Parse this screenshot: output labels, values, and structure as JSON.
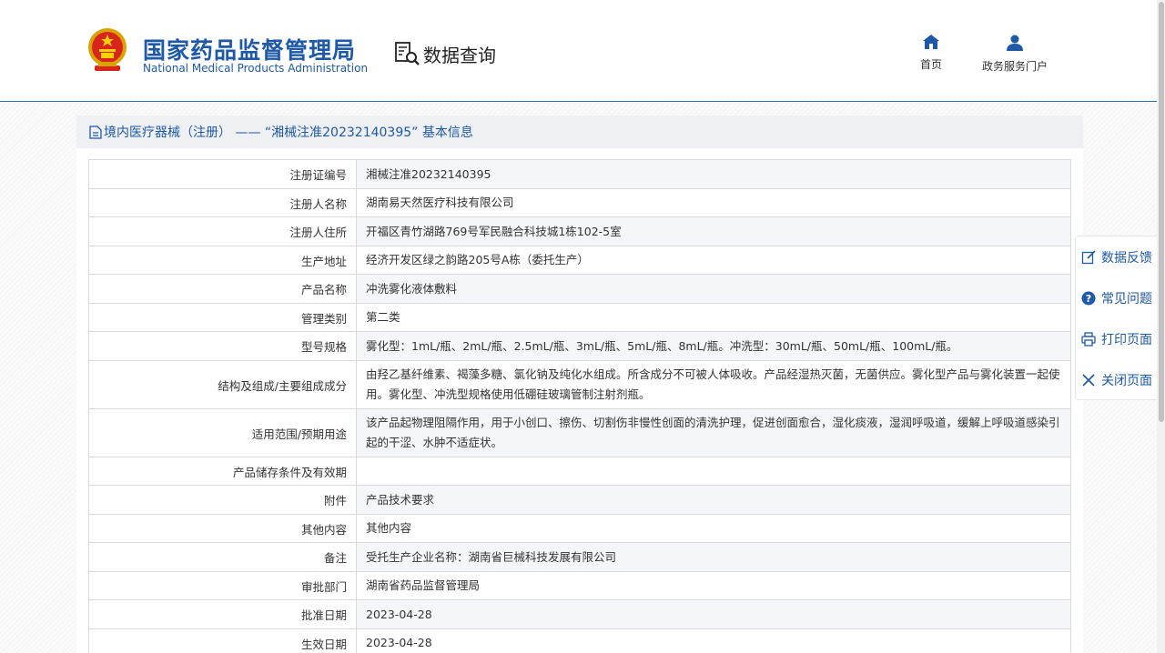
{
  "header": {
    "title_cn": "国家药品监督管理局",
    "title_en": "National Medical Products Administration",
    "query_label": "数据查询",
    "nav": [
      {
        "label": "首页",
        "icon": "home-icon"
      },
      {
        "label": "政务服务门户",
        "icon": "user-icon"
      }
    ]
  },
  "panel": {
    "title": "境内医疗器械（注册） —— “湘械注准20232140395” 基本信息"
  },
  "record": {
    "rows": [
      {
        "label": "注册证编号",
        "value": "湘械注准20232140395"
      },
      {
        "label": "注册人名称",
        "value": "湖南易天然医疗科技有限公司"
      },
      {
        "label": "注册人住所",
        "value": "开福区青竹湖路769号军民融合科技城1栋102-5室"
      },
      {
        "label": "生产地址",
        "value": "经济开发区绿之韵路205号A栋（委托生产）"
      },
      {
        "label": "产品名称",
        "value": "冲洗雾化液体敷料"
      },
      {
        "label": "管理类别",
        "value": "第二类"
      },
      {
        "label": "型号规格",
        "value": "雾化型：1mL/瓶、2mL/瓶、2.5mL/瓶、3mL/瓶、5mL/瓶、8mL/瓶。冲洗型：30mL/瓶、50mL/瓶、100mL/瓶。"
      },
      {
        "label": "结构及组成/主要组成成分",
        "value": "由羟乙基纤维素、褐藻多糖、氯化钠及纯化水组成。所含成分不可被人体吸收。产品经湿热灭菌，无菌供应。雾化型产品与雾化装置一起使用。雾化型、冲洗型规格使用低硼硅玻璃管制注射剂瓶。"
      },
      {
        "label": "适用范围/预期用途",
        "value": "该产品起物理阻隔作用，用于小创口、擦伤、切割伤非慢性创面的清洗护理，促进创面愈合，湿化痰液，湿润呼吸道，缓解上呼吸道感染引起的干涩、水肿不适症状。"
      },
      {
        "label": "产品储存条件及有效期",
        "value": ""
      },
      {
        "label": "附件",
        "value": "产品技术要求"
      },
      {
        "label": "其他内容",
        "value": "其他内容"
      },
      {
        "label": "备注",
        "value": "受托生产企业名称：湖南省巨械科技发展有限公司"
      },
      {
        "label": "审批部门",
        "value": "湖南省药品监督管理局"
      },
      {
        "label": "批准日期",
        "value": "2023-04-28"
      },
      {
        "label": "生效日期",
        "value": "2023-04-28"
      }
    ]
  },
  "sidebar": {
    "items": [
      {
        "label": "数据反馈",
        "icon": "edit-icon"
      },
      {
        "label": "常见问题",
        "icon": "question-icon"
      },
      {
        "label": "打印页面",
        "icon": "print-icon"
      },
      {
        "label": "关闭页面",
        "icon": "close-icon"
      }
    ]
  },
  "colors": {
    "brand": "#1d59a6",
    "row_alt": "#f5f6f9",
    "header_bar": "#eef0f4"
  }
}
